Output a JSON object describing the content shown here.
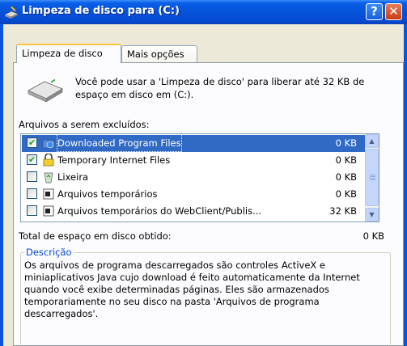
{
  "window": {
    "title": "Limpeza de disco para  (C:)",
    "help_label": "?",
    "close_label": "✕"
  },
  "tabs": [
    {
      "label": "Limpeza de disco",
      "active": true
    },
    {
      "label": "Mais opções",
      "active": false
    }
  ],
  "intro": {
    "text": "Você pode usar a 'Limpeza de disco' para liberar até 32 KB de espaço em disco em  (C:)."
  },
  "files_section": {
    "label": "Arquivos a serem excluídos:",
    "items": [
      {
        "name": "Downloaded Program Files",
        "size": "0 KB",
        "checked": true,
        "selected": true,
        "icon": "folder-globe-icon"
      },
      {
        "name": "Temporary Internet Files",
        "size": "0 KB",
        "checked": true,
        "selected": false,
        "icon": "lock-icon"
      },
      {
        "name": "Lixeira",
        "size": "0 KB",
        "checked": false,
        "selected": false,
        "icon": "recycle-bin-icon"
      },
      {
        "name": "Arquivos temporários",
        "size": "0 KB",
        "checked": false,
        "selected": false,
        "icon": "document-icon"
      },
      {
        "name": "Arquivos temporários do WebClient/Publis...",
        "size": "32 KB",
        "checked": false,
        "selected": false,
        "icon": "document-icon"
      }
    ]
  },
  "total": {
    "label": "Total de espaço em disco obtido:",
    "value": "0 KB"
  },
  "description": {
    "title": "Descrição",
    "text": "Os arquivos de programa descarregados são controles ActiveX e miniaplicativos Java cujo download é feito automaticamente da Internet quando você exibe determinadas páginas. Eles são armazenados temporariamente no seu disco na pasta 'Arquivos de programa descarregados'."
  },
  "colors": {
    "titlebar": "#0552d8",
    "selection": "#316ac5",
    "group_title": "#0046d5"
  }
}
